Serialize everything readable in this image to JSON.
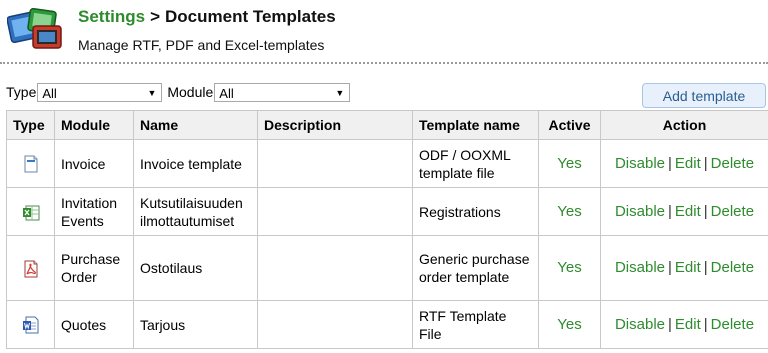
{
  "header": {
    "breadcrumb_link": "Settings",
    "breadcrumb_separator": ">",
    "breadcrumb_current": "Document Templates",
    "subtitle": "Manage RTF, PDF and Excel-templates",
    "app_icon": "windows-app-icon"
  },
  "filters": {
    "type_label": "Type",
    "type_value": "All",
    "module_label": "Module",
    "module_value": "All"
  },
  "actions": {
    "add_template_label": "Add template"
  },
  "table": {
    "headers": {
      "type": "Type",
      "module": "Module",
      "name": "Name",
      "description": "Description",
      "template_name": "Template name",
      "active": "Active",
      "action": "Action"
    },
    "rows": [
      {
        "type_icon": "odf-document-icon",
        "module": "Invoice",
        "name": "Invoice template",
        "description": "",
        "template_name": "ODF / OOXML template file",
        "active": "Yes",
        "disable": "Disable",
        "edit": "Edit",
        "delete": "Delete"
      },
      {
        "type_icon": "excel-file-icon",
        "module": "Invitation Events",
        "name": "Kutsutilaisuuden ilmottautumiset",
        "description": "",
        "template_name": "Registrations",
        "active": "Yes",
        "disable": "Disable",
        "edit": "Edit",
        "delete": "Delete"
      },
      {
        "type_icon": "pdf-file-icon",
        "module": "Purchase Order",
        "name": "Ostotilaus",
        "description": "",
        "template_name": "Generic purchase order template",
        "active": "Yes",
        "disable": "Disable",
        "edit": "Edit",
        "delete": "Delete"
      },
      {
        "type_icon": "word-file-icon",
        "module": "Quotes",
        "name": "Tarjous",
        "description": "",
        "template_name": "RTF Template File",
        "active": "Yes",
        "disable": "Disable",
        "edit": "Edit",
        "delete": "Delete"
      }
    ],
    "action_separator": "|"
  },
  "colors": {
    "accent_green": "#2e8b2e",
    "button_bg": "#e8f1fb",
    "button_text": "#2a5d91",
    "header_bg": "#f0f0f0"
  }
}
